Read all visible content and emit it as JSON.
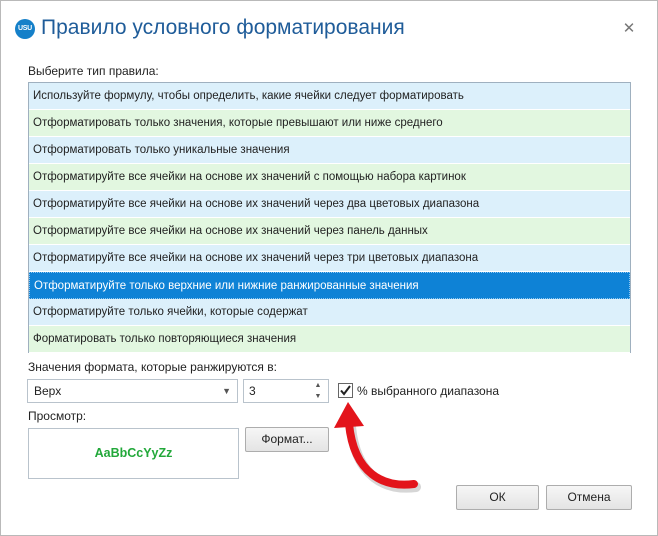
{
  "window": {
    "title": "Правило условного форматирования",
    "app_icon_text": "USU",
    "close_glyph": "✕"
  },
  "rule_type": {
    "label": "Выберите тип правила:",
    "items": [
      "Используйте формулу, чтобы определить, какие ячейки следует форматировать",
      "Отформатировать только значения, которые превышают или ниже среднего",
      "Отформатировать только уникальные значения",
      "Отформатируйте все ячейки на основе их значений с помощью набора картинок",
      "Отформатируйте все ячейки на основе их значений через два цветовых диапазона",
      "Отформатируйте все ячейки на основе их значений через панель данных",
      "Отформатируйте все ячейки на основе их значений через три цветовых диапазона",
      "Отформатируйте только верхние или нижние ранжированные значения",
      "Отформатируйте только ячейки, которые содержат",
      "Форматировать только повторяющиеся значения"
    ],
    "selected_index": 7
  },
  "rank": {
    "label": "Значения формата, которые ранжируются в:",
    "direction_value": "Верх",
    "count_value": "3",
    "percent_label": "% выбранного диапазона",
    "percent_checked": true
  },
  "preview": {
    "label": "Просмотр:",
    "sample_text": "AaBbCcYyZz"
  },
  "buttons": {
    "format": "Формат...",
    "ok": "ОК",
    "cancel": "Отмена"
  },
  "colors": {
    "title": "#1f5c99",
    "selected_row": "#0e82d6",
    "row_blue": "#dcf0fb",
    "row_green": "#e2f7e0",
    "preview_text": "#22a83a",
    "annotation_arrow": "#e3141b"
  },
  "icons": {
    "close": "close-icon",
    "dropdown": "chevron-down-icon",
    "spin_up": "triangle-up-icon",
    "spin_down": "triangle-down-icon",
    "check": "checkmark-icon",
    "annotation": "red-curved-arrow-icon"
  }
}
